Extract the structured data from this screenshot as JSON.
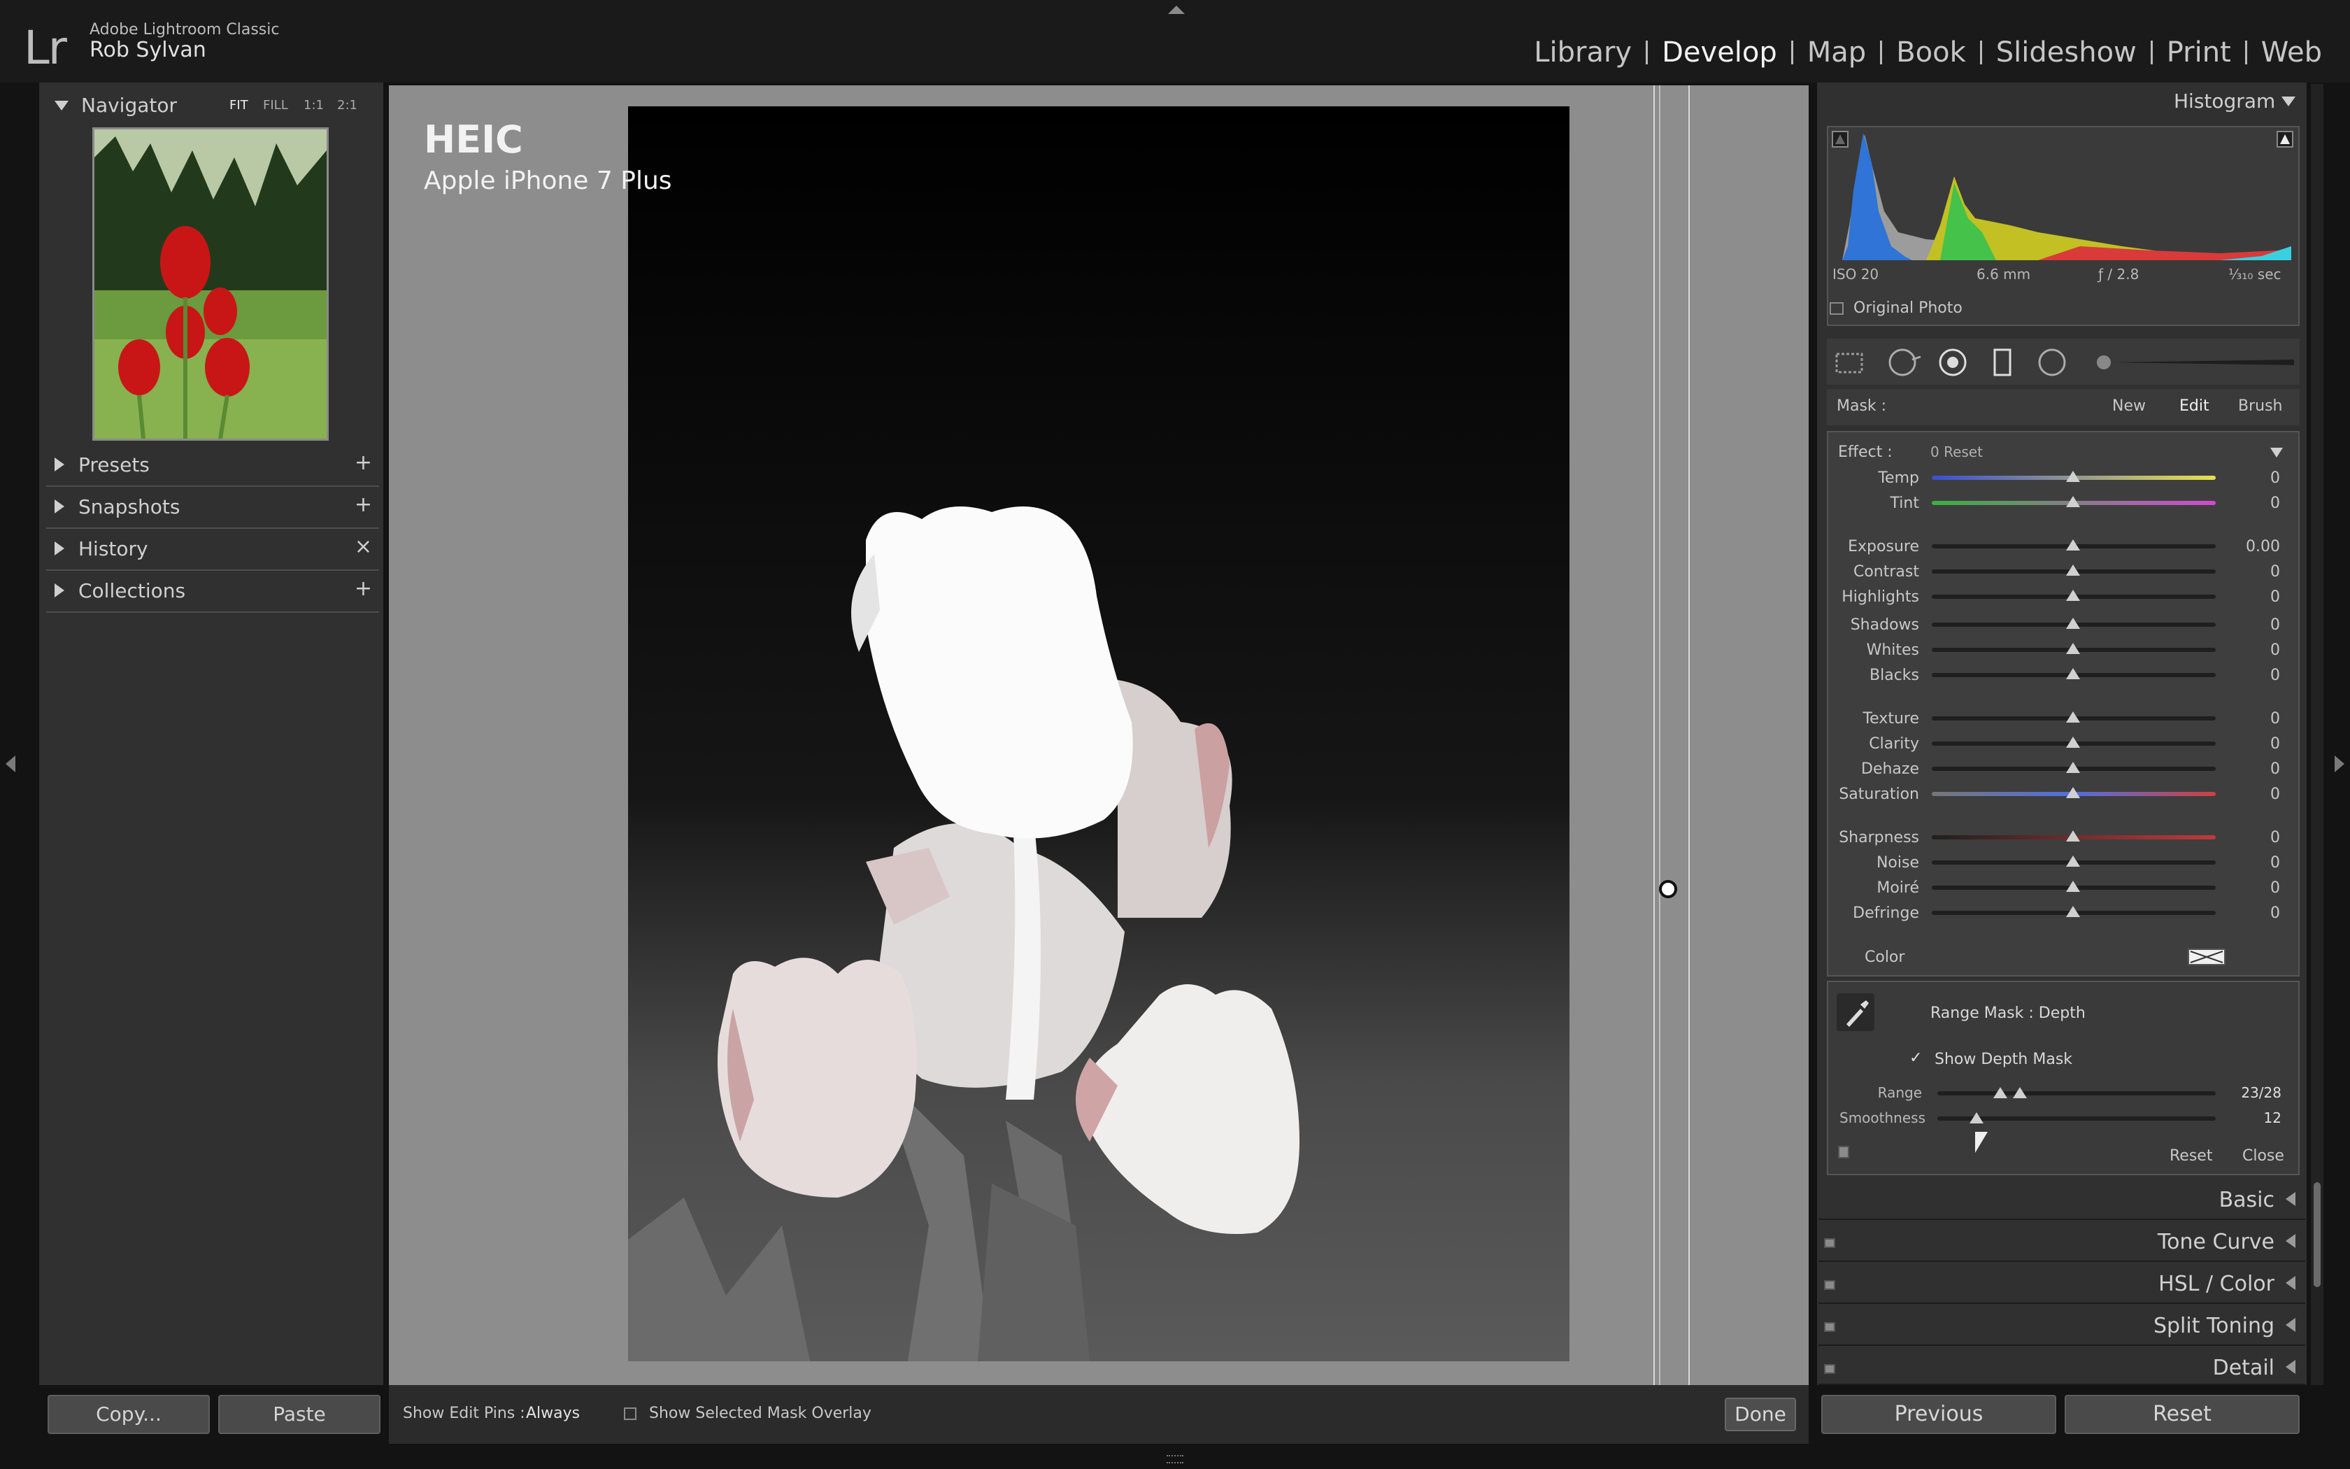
{
  "app": {
    "name": "Adobe Lightroom Classic",
    "user": "Rob Sylvan",
    "logo": "Lr"
  },
  "modules": [
    "Library",
    "Develop",
    "Map",
    "Book",
    "Slideshow",
    "Print",
    "Web"
  ],
  "active_module": "Develop",
  "left_panel": {
    "navigator": {
      "title": "Navigator",
      "zoom_options": [
        "FIT",
        "FILL",
        "1:1",
        "2:1"
      ]
    },
    "panels": [
      {
        "title": "Presets",
        "action": "+"
      },
      {
        "title": "Snapshots",
        "action": "+"
      },
      {
        "title": "History",
        "action": "×"
      },
      {
        "title": "Collections",
        "action": "+"
      }
    ],
    "copy_label": "Copy...",
    "paste_label": "Paste"
  },
  "photo_info": {
    "format": "HEIC",
    "camera": "Apple iPhone 7 Plus"
  },
  "toolbar": {
    "edit_pins_label": "Show Edit Pins :",
    "edit_pins_value": "Always",
    "mask_overlay_label": "Show Selected Mask Overlay",
    "done_label": "Done"
  },
  "right_panel": {
    "histogram": {
      "title": "Histogram",
      "iso": "ISO 20",
      "focal": "6.6 mm",
      "aperture": "ƒ / 2.8",
      "shutter": "¹⁄₃₁₀ sec",
      "original_photo": "Original Photo"
    },
    "mask": {
      "label": "Mask :",
      "new": "New",
      "edit": "Edit",
      "brush": "Brush"
    },
    "effect": {
      "label": "Effect :",
      "preset": "0 Reset"
    },
    "sliders": [
      {
        "name": "Temp",
        "value": "0"
      },
      {
        "name": "Tint",
        "value": "0"
      },
      {
        "name": "Exposure",
        "value": "0.00"
      },
      {
        "name": "Contrast",
        "value": "0"
      },
      {
        "name": "Highlights",
        "value": "0"
      },
      {
        "name": "Shadows",
        "value": "0"
      },
      {
        "name": "Whites",
        "value": "0"
      },
      {
        "name": "Blacks",
        "value": "0"
      },
      {
        "name": "Texture",
        "value": "0"
      },
      {
        "name": "Clarity",
        "value": "0"
      },
      {
        "name": "Dehaze",
        "value": "0"
      },
      {
        "name": "Saturation",
        "value": "0"
      },
      {
        "name": "Sharpness",
        "value": "0"
      },
      {
        "name": "Noise",
        "value": "0"
      },
      {
        "name": "Moiré",
        "value": "0"
      },
      {
        "name": "Defringe",
        "value": "0"
      }
    ],
    "color_label": "Color",
    "range_mask": {
      "label": "Range Mask : Depth",
      "show_depth_mask": "Show Depth Mask",
      "range_label": "Range",
      "range_value": "23/28",
      "smoothness_label": "Smoothness",
      "smoothness_value": "12",
      "reset": "Reset",
      "close": "Close"
    },
    "sections": [
      "Basic",
      "Tone Curve",
      "HSL / Color",
      "Split Toning",
      "Detail"
    ],
    "previous_label": "Previous",
    "reset_label": "Reset"
  }
}
